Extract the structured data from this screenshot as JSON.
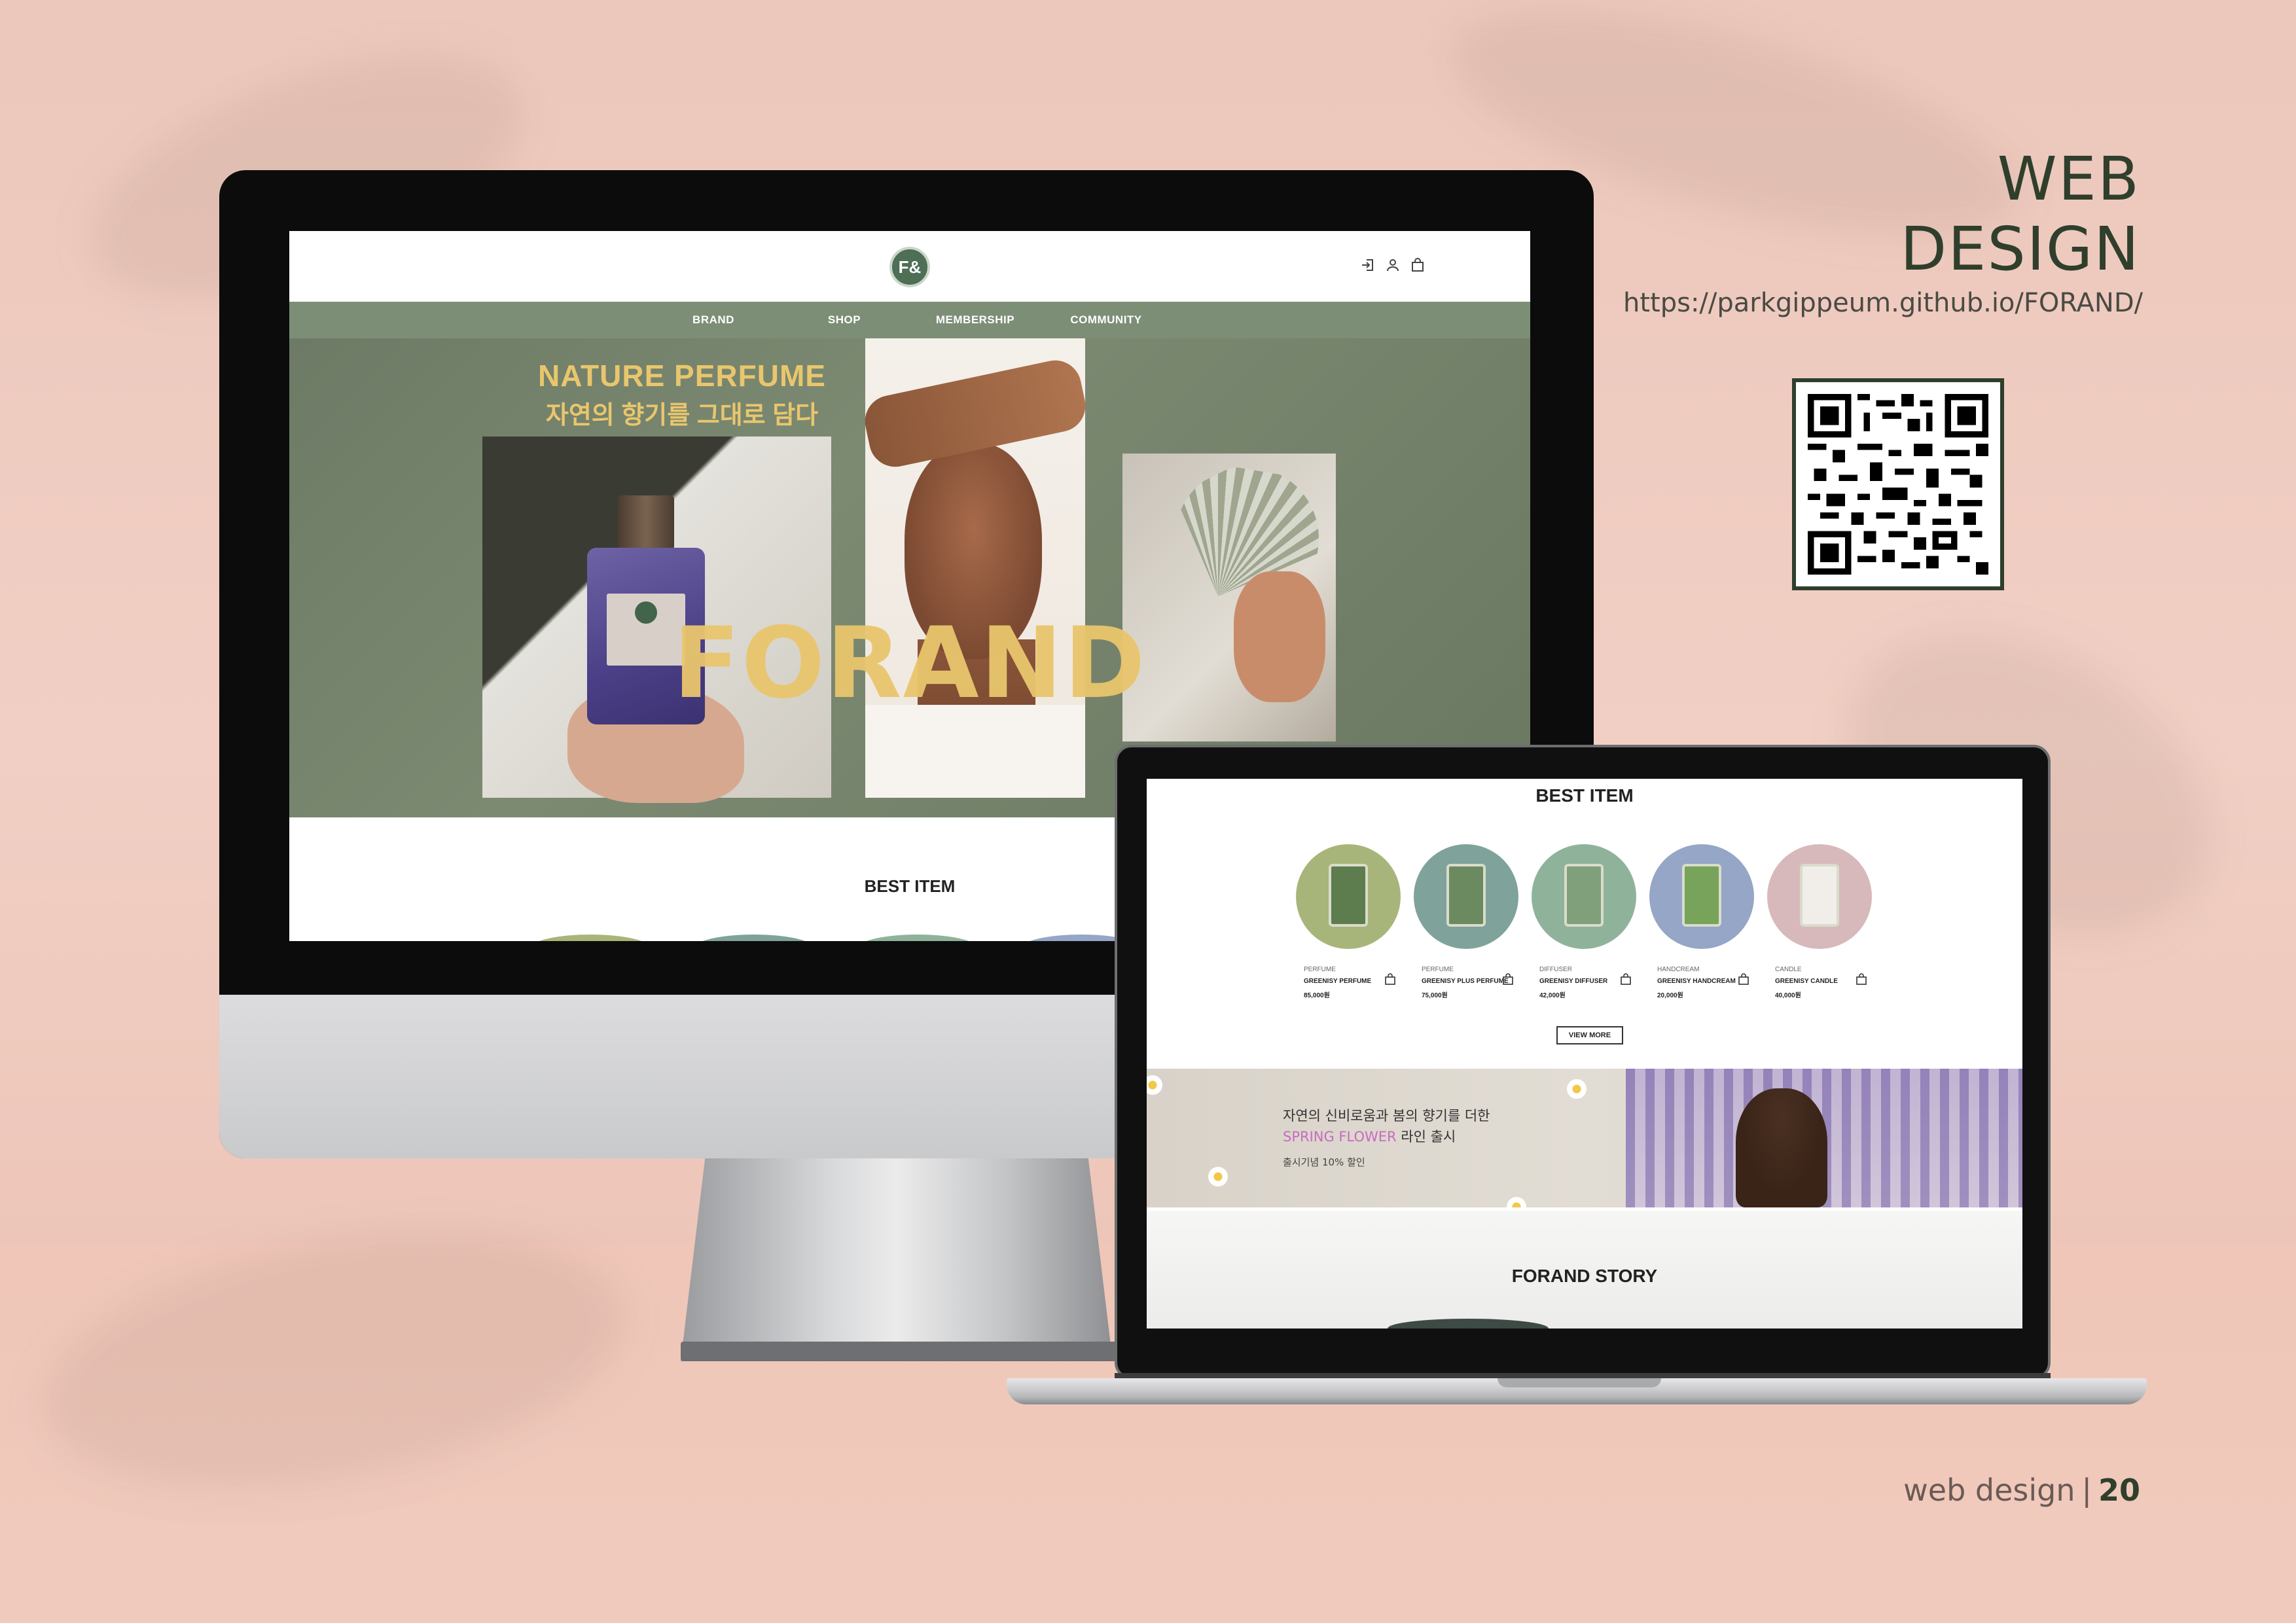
{
  "page": {
    "title": "WEB DESIGN",
    "url": "https://parkgippeum.github.io/FORAND/",
    "footer": {
      "label": "web design",
      "separator": "|",
      "page_number": "20"
    }
  },
  "site": {
    "logo_text": "F&",
    "nav": [
      "BRAND",
      "SHOP",
      "MEMBERSHIP",
      "COMMUNITY"
    ],
    "header_icons": [
      "login-icon",
      "user-icon",
      "bag-icon"
    ],
    "hero": {
      "title": "NATURE PERFUME",
      "subtitle": "자연의 향기를 그대로 담다",
      "brand": "FORAND"
    },
    "best_item_title": "BEST ITEM",
    "products": [
      {
        "category": "PERFUME",
        "name": "GREENISY PERFUME",
        "price": "85,000원",
        "bg": "#a8b57a"
      },
      {
        "category": "PERFUME",
        "name": "GREENISY PLUS PERFUME",
        "price": "75,000원",
        "bg": "#7fa39a"
      },
      {
        "category": "DIFFUSER",
        "name": "GREENISY DIFFUSER",
        "price": "42,000원",
        "bg": "#8fb39a"
      },
      {
        "category": "HANDCREAM",
        "name": "GREENISY HANDCREAM",
        "price": "20,000원",
        "bg": "#95a6c6"
      },
      {
        "category": "CANDLE",
        "name": "GREENISY CANDLE",
        "price": "40,000원",
        "bg": "#d8b9bb"
      }
    ],
    "view_more": "VIEW MORE",
    "banner": {
      "line1": "자연의 신비로움과 봄의 향기를 더한",
      "line2_accent": "SPRING FLOWER",
      "line2_rest": " 라인 출시",
      "line3": "출시기념 10% 할인"
    },
    "story_title": "FORAND STORY"
  },
  "colors": {
    "background": "#efcbbf",
    "title_green": "#2f3f2c",
    "nav_green": "#7d8e77",
    "hero_gold": "#e9c66d",
    "accent_pink": "#c76bc0"
  }
}
